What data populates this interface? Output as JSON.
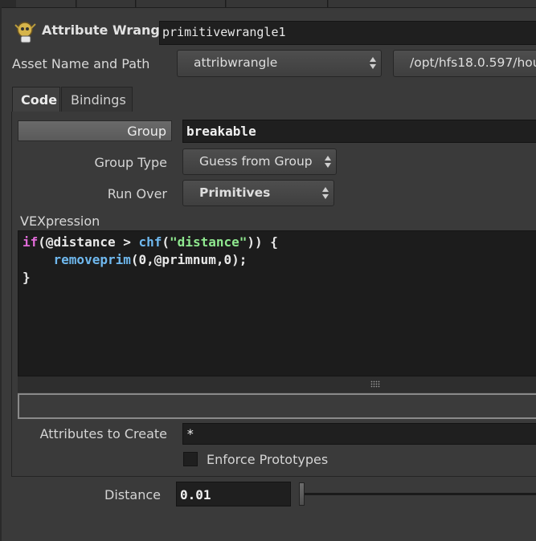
{
  "header": {
    "node_type": "Attribute Wrangle",
    "node_name": "primitivewrangle1",
    "asset_label": "Asset Name and Path",
    "asset_name": "attribwrangle",
    "asset_path": "/opt/hfs18.0.597/hou"
  },
  "tabs": [
    {
      "label": "Code",
      "active": true
    },
    {
      "label": "Bindings",
      "active": false
    }
  ],
  "params": {
    "group_label": "Group",
    "group_value": "breakable",
    "group_type_label": "Group Type",
    "group_type_value": "Guess from Group",
    "run_over_label": "Run Over",
    "run_over_value": "Primitives",
    "vex_label": "VEXpression",
    "code": {
      "line1_kw": "if",
      "line1_a": "(@distance > ",
      "line1_fn": "chf",
      "line1_b": "(",
      "line1_str": "\"distance\"",
      "line1_c": ")) {",
      "line2_indent": "    ",
      "line2_fn": "removeprim",
      "line2_a": "(0,@primnum,0);",
      "line3": "}"
    },
    "attributes_label": "Attributes to Create",
    "attributes_value": "*",
    "enforce_label": "Enforce Prototypes",
    "enforce_checked": false,
    "distance_label": "Distance",
    "distance_value": "0.01"
  },
  "icons": {
    "node": "wrangle-node-icon",
    "dropdown": "up-down-arrows-icon"
  }
}
